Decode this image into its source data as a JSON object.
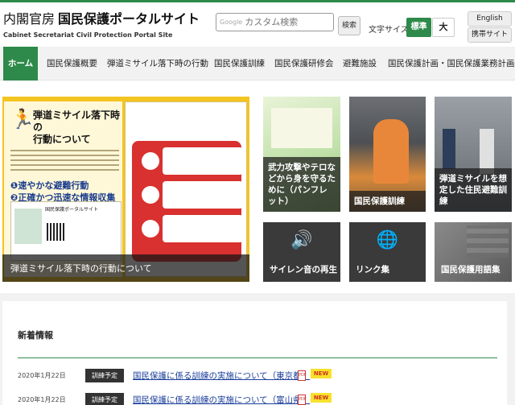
{
  "header": {
    "org": "内閣官房",
    "site_name": "国民保護ポータルサイト",
    "subtitle": "Cabinet Secretariat Civil Protection Portal Site",
    "search_brand": "Google",
    "search_placeholder": "カスタム検索",
    "search_button": "検索",
    "font_size_label": "文字サイズ",
    "font_standard": "標準",
    "font_large": "大",
    "english": "English",
    "mobile": "携帯サイト"
  },
  "nav": [
    {
      "label": "ホーム"
    },
    {
      "label": "国民保護概要"
    },
    {
      "label": "弾道ミサイル落下時の行動"
    },
    {
      "label": "国民保護訓練"
    },
    {
      "label": "国民保護研修会"
    },
    {
      "label": "避難施設"
    },
    {
      "label": "国民保護計画・国民保護業務計画"
    }
  ],
  "hero": {
    "title_line1": "弾道ミサイル落下時の",
    "title_line2": "行動について",
    "item1": "❶速やかな避難行動",
    "item2": "❷正確かつ迅速な情報収集",
    "flyer_title": "国民保護ポータルサイト",
    "caption": "弾道ミサイル落下時の行動について"
  },
  "tiles": {
    "pamphlet": "武力攻撃やテロなどから身を守るために（パンフレット）",
    "training": "国民保護訓練",
    "missile_training": "弾道ミサイルを想定した住民避難訓練",
    "siren": "サイレン音の再生",
    "links": "リンク集",
    "glossary": "国民保護用語集"
  },
  "news": {
    "heading": "新着情報",
    "items": [
      {
        "date": "2020年1月22日",
        "tag": "訓練予定",
        "text": "国民保護に係る訓練の実施について（東京都）",
        "new": "NEW"
      },
      {
        "date": "2020年1月22日",
        "tag": "訓練予定",
        "text": "国民保護に係る訓練の実施について（富山県）",
        "new": "NEW"
      }
    ]
  },
  "colors": {
    "accent_green": "#2e8a4a",
    "banner_yellow": "#f4c421",
    "link_blue": "#1a3e9a",
    "new_badge": "#f7e12c"
  }
}
